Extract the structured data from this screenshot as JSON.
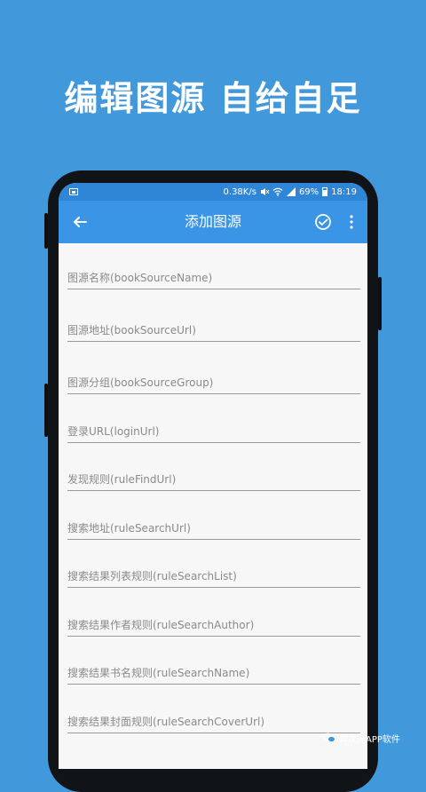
{
  "promo": {
    "title": "编辑图源  自给自足"
  },
  "status_bar": {
    "network_speed": "0.38K/s",
    "battery_percent": "69%",
    "time": "18:19",
    "icons": [
      "image-icon",
      "mute-icon",
      "wifi-icon",
      "signal-icon",
      "battery-icon"
    ]
  },
  "app_bar": {
    "title": "添加图源",
    "icons": [
      "arrow-left-icon",
      "check-circle-icon",
      "more-vertical-icon"
    ]
  },
  "form": {
    "fields": [
      {
        "placeholder": "图源名称(bookSourceName)",
        "value": ""
      },
      {
        "placeholder": "图源地址(bookSourceUrl)",
        "value": ""
      },
      {
        "placeholder": "图源分组(bookSourceGroup)",
        "value": ""
      },
      {
        "placeholder": "登录URL(loginUrl)",
        "value": ""
      },
      {
        "placeholder": "发现规则(ruleFindUrl)",
        "value": ""
      },
      {
        "placeholder": "搜索地址(ruleSearchUrl)",
        "value": ""
      },
      {
        "placeholder": "搜索结果列表规则(ruleSearchList)",
        "value": ""
      },
      {
        "placeholder": "搜索结果作者规则(ruleSearchAuthor)",
        "value": ""
      },
      {
        "placeholder": "搜索结果书名规则(ruleSearchName)",
        "value": ""
      },
      {
        "placeholder": "搜索结果封面规则(ruleSearchCoverUrl)",
        "value": ""
      }
    ]
  },
  "watermark": {
    "text": "异次元APP软件",
    "icon": "wechat-icon"
  },
  "colors": {
    "background": "#4199dc",
    "status_bar": "#2f86d6",
    "app_bar": "#3a95e6",
    "screen": "#f7f7f7"
  }
}
